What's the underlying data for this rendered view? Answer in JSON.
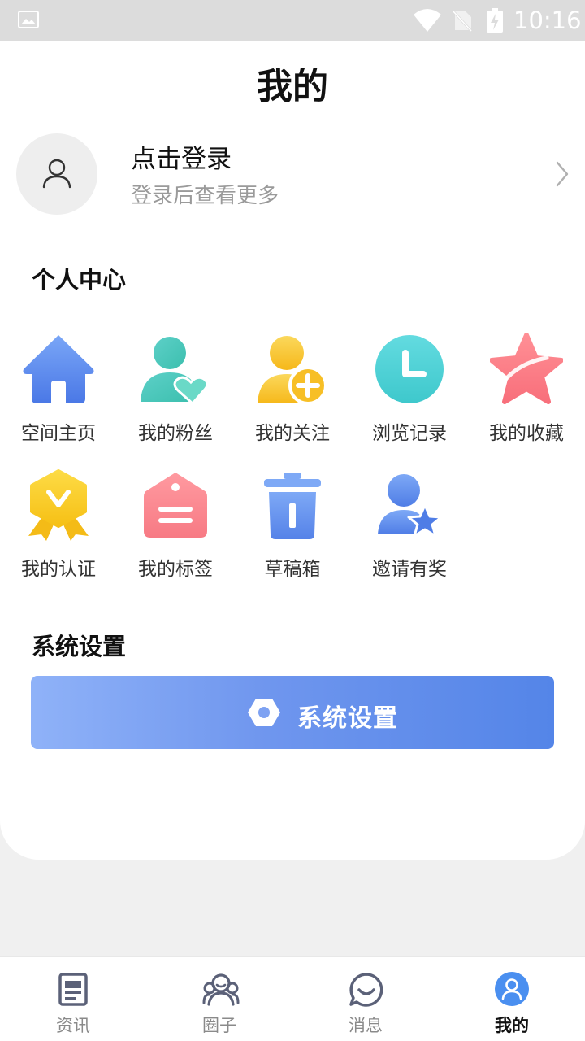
{
  "status_bar": {
    "time": "10:16"
  },
  "header": {
    "title": "我的"
  },
  "login": {
    "title": "点击登录",
    "subtitle": "登录后查看更多"
  },
  "personal_center": {
    "title": "个人中心",
    "items": [
      {
        "label": "空间主页",
        "icon": "home-icon"
      },
      {
        "label": "我的粉丝",
        "icon": "fans-icon"
      },
      {
        "label": "我的关注",
        "icon": "follow-icon"
      },
      {
        "label": "浏览记录",
        "icon": "clock-icon"
      },
      {
        "label": "我的收藏",
        "icon": "star-icon"
      },
      {
        "label": "我的认证",
        "icon": "badge-icon"
      },
      {
        "label": "我的标签",
        "icon": "tag-icon"
      },
      {
        "label": "草稿箱",
        "icon": "trash-icon"
      },
      {
        "label": "邀请有奖",
        "icon": "invite-icon"
      }
    ]
  },
  "system": {
    "title": "系统设置",
    "button_label": "系统设置"
  },
  "bottom_nav": {
    "items": [
      {
        "label": "资讯",
        "icon": "news-icon"
      },
      {
        "label": "圈子",
        "icon": "group-icon"
      },
      {
        "label": "消息",
        "icon": "message-icon"
      },
      {
        "label": "我的",
        "icon": "profile-icon",
        "active": true
      }
    ]
  },
  "colors": {
    "accent": "#4f86ea",
    "active_nav": "#4a8ff0"
  }
}
